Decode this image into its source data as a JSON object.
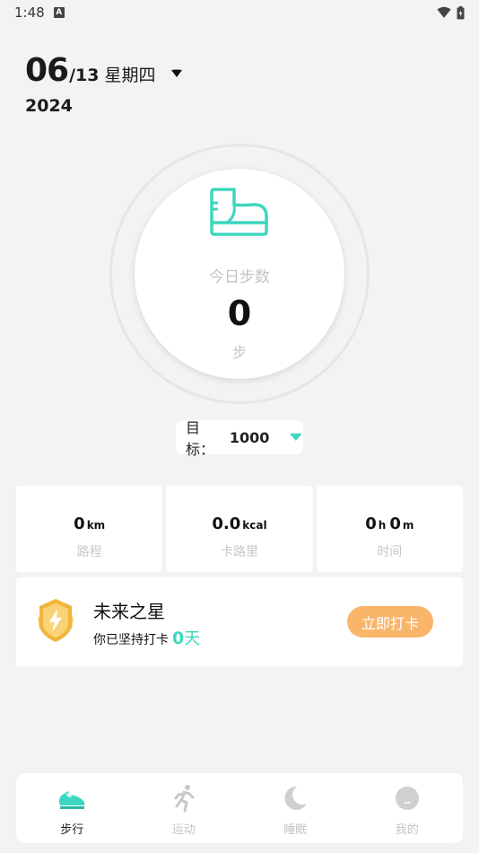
{
  "status_bar": {
    "time": "1:48",
    "notification_icon": "a-icon",
    "wifi_icon": "wifi-icon",
    "battery_icon": "battery-icon"
  },
  "date": {
    "day_big": "06",
    "month_small": "/13",
    "weekday": "星期四",
    "year": "2024"
  },
  "steps": {
    "label": "今日步数",
    "value": "0",
    "unit": "步",
    "icon": "boot-icon"
  },
  "goal": {
    "label": "目标：",
    "value": "1000"
  },
  "stats": [
    {
      "value": "0",
      "unit": "km",
      "label": "路程"
    },
    {
      "value": "0.0",
      "unit": "kcal",
      "label": "卡路里"
    },
    {
      "value_h": "0",
      "unit_h": "h",
      "value_m": "0",
      "unit_m": "m",
      "label": "时间"
    }
  ],
  "checkin": {
    "title": "未来之星",
    "sub_text": "你已坚持打卡",
    "days": "0",
    "days_unit": "天",
    "button_label": "立即打卡",
    "badge_icon": "lightning-badge-icon"
  },
  "tabs": [
    {
      "label": "步行",
      "icon": "sneaker-icon",
      "active": true
    },
    {
      "label": "运动",
      "icon": "running-person-icon",
      "active": false
    },
    {
      "label": "睡眠",
      "icon": "moon-icon",
      "active": false
    },
    {
      "label": "我的",
      "icon": "profile-icon",
      "active": false
    }
  ],
  "colors": {
    "accent": "#3ed6c0",
    "button": "#f9b56a",
    "background": "#f3f3f5"
  }
}
